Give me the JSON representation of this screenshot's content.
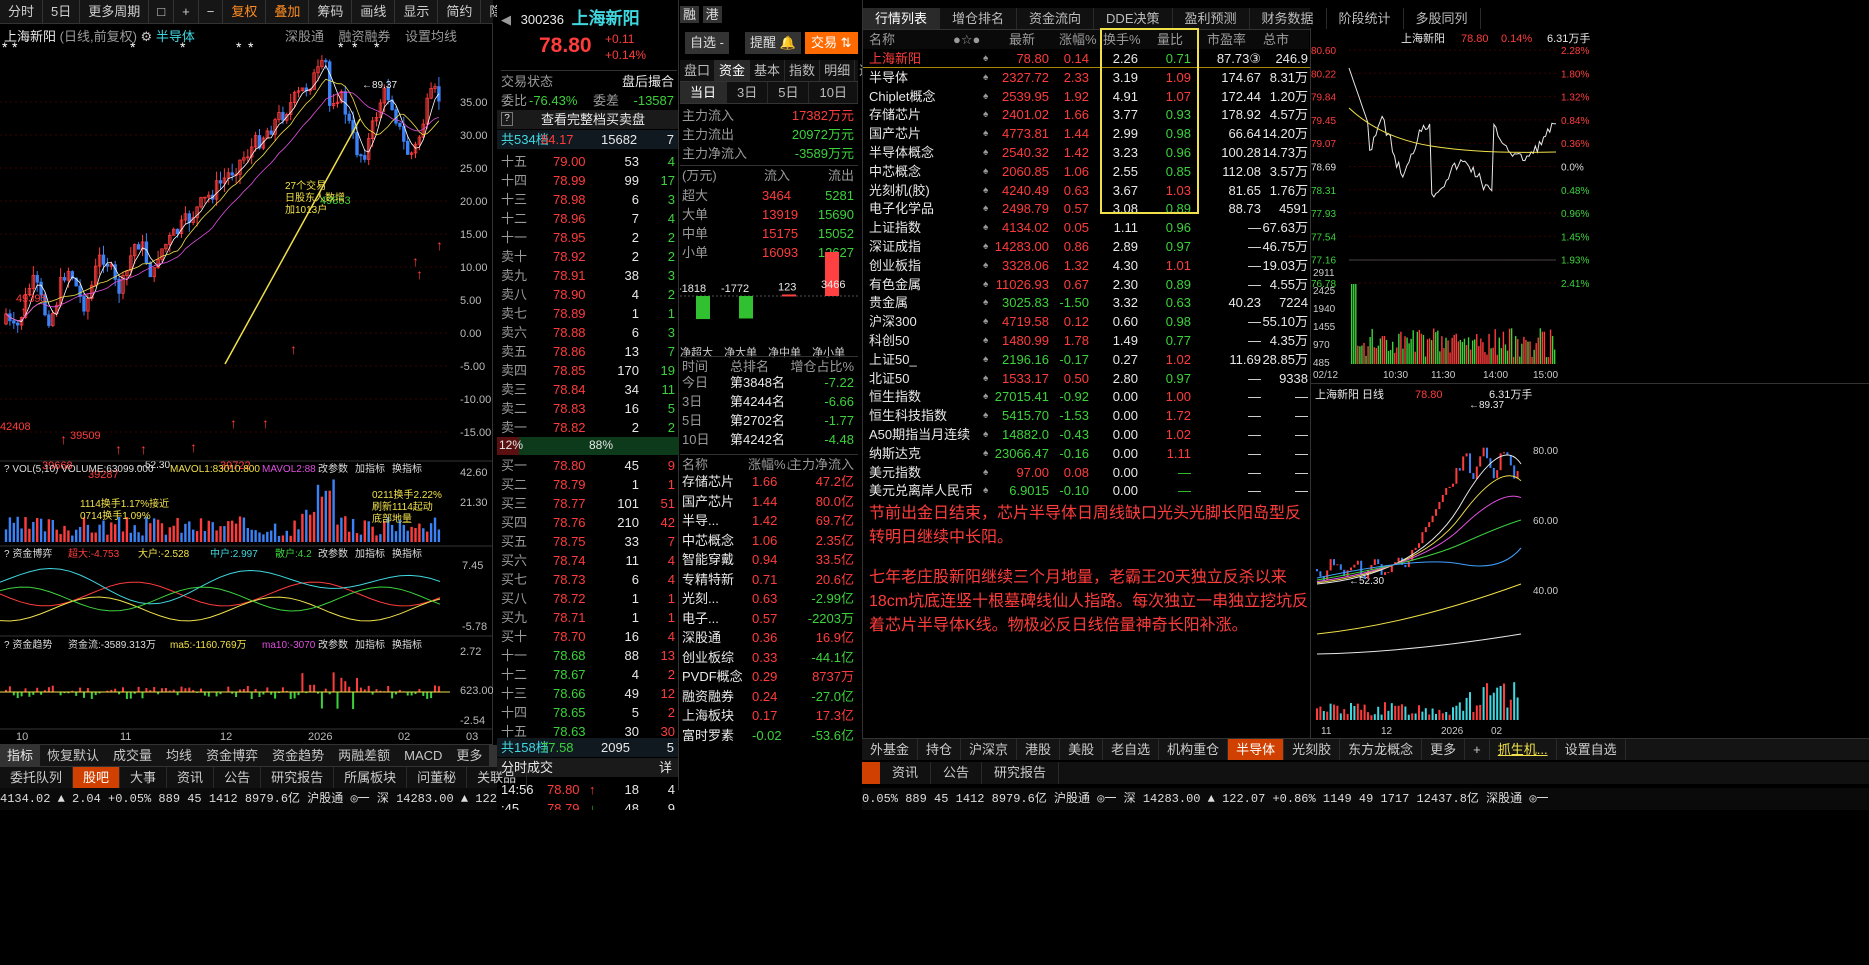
{
  "toolbar": {
    "items": [
      "分时",
      "5日",
      "更多周期",
      "□",
      "+",
      "−",
      "复权",
      "叠加",
      "筹码",
      "画线",
      "显示",
      "简约",
      "隐藏"
    ]
  },
  "kline": {
    "title": "上海新阳",
    "sub": "(日线,前复权)",
    "sector": "半导体",
    "links": [
      "深股通",
      "融资融券",
      "设置均线"
    ],
    "yticks": [
      "35.00",
      "30.00",
      "25.00",
      "20.00",
      "15.00",
      "10.00",
      "5.00",
      "0.00",
      "-5.00",
      "-10.00",
      "-15.00"
    ],
    "high_label": "89.37",
    "low_label": "52.30",
    "price_labels": [
      "49853",
      "42408",
      "49395",
      "39509",
      "39668",
      "39722",
      "39287"
    ],
    "annotation": "27个交易日股东人数增加1013户",
    "vol_header": "VOL(5,10)",
    "vol_text": "VOLUME:63099.000",
    "vol_ma5": "MAVOL1:83010.800",
    "vol_ma10": "MAVOL2:88",
    "vol_params": "改参数",
    "vol_add": "加指标",
    "vol_switch": "换指标",
    "vol_ticks": [
      "42.60",
      "21.30"
    ],
    "vol_note1": "1114换手1.17%接近",
    "vol_note2": "0714换手1.09%",
    "vol_note3": "0211换手2.22%",
    "vol_note4": "刷新1114起动",
    "vol_note5": "底部地量",
    "fund_header": "资金博弈",
    "fund_big": "超大:-4.753",
    "fund_large": "大户:-2.528",
    "fund_mid": "中户:2.997",
    "fund_small": "散户:4.2",
    "fund_params": "改参数",
    "fund_add": "加指标",
    "fund_switch": "换指标",
    "fund_ticks": [
      "7.45",
      "-5.78"
    ],
    "trend_header": "资金趋势",
    "trend_flow": "资金流:-3589.313万",
    "trend_ma5": "ma5:-1160.769万",
    "trend_ma10": "ma10:-3070",
    "trend_params": "改参数",
    "trend_add": "加指标",
    "trend_switch": "换指标",
    "trend_ticks": [
      "2.72",
      "623.00",
      "-2.54"
    ],
    "xaxis": [
      "10",
      "11",
      "12",
      "2026",
      "02",
      "03"
    ],
    "bottom_tabs": [
      "指标",
      "恢复默认",
      "成交量",
      "均线",
      "资金博弈",
      "资金趋势",
      "两融差额",
      "MACD",
      "更多",
      "模板"
    ]
  },
  "quote": {
    "code": "300236",
    "name": "上海新阳",
    "price": "78.80",
    "chg": "+0.11",
    "pct": "+0.14%",
    "tags": [
      "融",
      "港"
    ],
    "btn_watch": "自选 -",
    "btn_alert": "提醒",
    "btn_trade": "交易",
    "status_label": "交易状态",
    "status_val": "盘后撮合",
    "wb_label": "委比",
    "wb_val": "-76.43%",
    "wc_label": "委差",
    "wc_val": "-13587",
    "full_btn": "查看完整档买卖盘",
    "sell_summary": {
      "label": "共534档",
      "price": "84.17",
      "vol": "15682",
      "cnt": "7"
    },
    "sells": [
      [
        "十五",
        "79.00",
        "53",
        "4"
      ],
      [
        "十四",
        "78.99",
        "99",
        "17"
      ],
      [
        "十三",
        "78.98",
        "6",
        "3"
      ],
      [
        "十二",
        "78.96",
        "7",
        "4"
      ],
      [
        "十一",
        "78.95",
        "2",
        "2"
      ],
      [
        "卖十",
        "78.92",
        "2",
        "2"
      ],
      [
        "卖九",
        "78.91",
        "38",
        "3"
      ],
      [
        "卖八",
        "78.90",
        "4",
        "2"
      ],
      [
        "卖七",
        "78.89",
        "1",
        "1"
      ],
      [
        "卖六",
        "78.88",
        "6",
        "3"
      ],
      [
        "卖五",
        "78.86",
        "13",
        "7"
      ],
      [
        "卖四",
        "78.85",
        "170",
        "19"
      ],
      [
        "卖三",
        "78.84",
        "34",
        "11"
      ],
      [
        "卖二",
        "78.83",
        "16",
        "5"
      ],
      [
        "卖一",
        "78.82",
        "2",
        "2"
      ]
    ],
    "ratio_left": "12%",
    "ratio_mid": "88%",
    "buys": [
      [
        "买一",
        "78.80",
        "45",
        "9"
      ],
      [
        "买二",
        "78.79",
        "1",
        "1"
      ],
      [
        "买三",
        "78.77",
        "101",
        "51"
      ],
      [
        "买四",
        "78.76",
        "210",
        "42"
      ],
      [
        "买五",
        "78.75",
        "33",
        "7"
      ],
      [
        "买六",
        "78.74",
        "11",
        "4"
      ],
      [
        "买七",
        "78.73",
        "6",
        "4"
      ],
      [
        "买八",
        "78.72",
        "1",
        "1"
      ],
      [
        "买九",
        "78.71",
        "1",
        "1"
      ],
      [
        "买十",
        "78.70",
        "16",
        "4"
      ],
      [
        "十一",
        "78.68",
        "88",
        "13"
      ],
      [
        "十二",
        "78.67",
        "4",
        "2"
      ],
      [
        "十三",
        "78.66",
        "49",
        "12"
      ],
      [
        "十四",
        "78.65",
        "5",
        "2"
      ],
      [
        "十五",
        "78.63",
        "30",
        "30"
      ]
    ],
    "buy_summary": {
      "label": "共158档",
      "price": "77.58",
      "vol": "2095",
      "cnt": "5"
    },
    "ticks_title": "分时成交",
    "ticks_detail": "详",
    "ticks": [
      [
        "14:56",
        "78.80",
        "↑",
        "18",
        "4"
      ],
      [
        ":45",
        "78.79",
        "↓",
        "48",
        "9"
      ],
      [
        ":48",
        "78.78",
        "↓",
        "16",
        "4"
      ],
      [
        ":51",
        "78.78",
        "",
        "19",
        "8"
      ],
      [
        ":54",
        "78.77",
        "↓",
        "28",
        "3"
      ],
      [
        ":57",
        "78.76",
        "↓",
        "5",
        "3"
      ],
      [
        "14:57",
        "78.80",
        "↑",
        "2",
        "1"
      ],
      [
        "15:00",
        "78.80",
        "",
        "1144",
        "231"
      ]
    ]
  },
  "fund": {
    "tabs": [
      "盘口",
      "资金",
      "基本",
      "指数",
      "明细",
      "逐笔"
    ],
    "periods": [
      "当日",
      "3日",
      "5日",
      "10日"
    ],
    "main_in_label": "主力流入",
    "main_in": "17382万元",
    "main_out_label": "主力流出",
    "main_out": "20972万元",
    "main_net_label": "主力净流入",
    "main_net": "-3589万元",
    "table_head": [
      "(万元)",
      "流入",
      "流出"
    ],
    "rows": [
      [
        "超大",
        "3464",
        "5281"
      ],
      [
        "大单",
        "13919",
        "15690"
      ],
      [
        "中单",
        "15175",
        "15052"
      ],
      [
        "小单",
        "16093",
        "12627"
      ]
    ],
    "bars": [
      -1818,
      -1772,
      123,
      3466
    ],
    "bar_labels": [
      "-1818",
      "-1772",
      "123",
      "3466"
    ],
    "bar_cats": [
      "净超大",
      "净大单",
      "净中单",
      "净小单"
    ],
    "rank_head": [
      "时间",
      "总排名",
      "增仓占比%"
    ],
    "ranks": [
      [
        "今日",
        "第3848名",
        "-7.22"
      ],
      [
        "3日",
        "第4244名",
        "-6.66"
      ],
      [
        "5日",
        "第2702名",
        "-1.77"
      ],
      [
        "10日",
        "第4242名",
        "-4.48"
      ]
    ],
    "sec_head": [
      "名称",
      "涨幅%↓",
      "主力净流入"
    ],
    "sectors": [
      [
        "存储芯片",
        "1.66",
        "47.2亿"
      ],
      [
        "国产芯片",
        "1.44",
        "80.0亿"
      ],
      [
        "半导...",
        "1.42",
        "69.7亿"
      ],
      [
        "中芯概念",
        "1.06",
        "2.35亿"
      ],
      [
        "智能穿戴",
        "0.94",
        "33.5亿"
      ],
      [
        "专精特新",
        "0.71",
        "20.6亿"
      ],
      [
        "光刻...",
        "0.63",
        "-2.99亿"
      ],
      [
        "电子...",
        "0.57",
        "-2203万"
      ],
      [
        "深股通",
        "0.36",
        "16.9亿"
      ],
      [
        "创业板综",
        "0.33",
        "-44.1亿"
      ],
      [
        "PVDF概念",
        "0.29",
        "8737万"
      ],
      [
        "融资融券",
        "0.24",
        "-27.0亿"
      ],
      [
        "上海板块",
        "0.17",
        "17.3亿"
      ],
      [
        "富时罗素",
        "-0.02",
        "-53.6亿"
      ]
    ]
  },
  "market": {
    "tabs": [
      "行情列表",
      "增仓排名",
      "资金流向",
      "DDE决策",
      "盈利预测",
      "财务数据",
      "阶段统计",
      "多股同列"
    ],
    "head": [
      "名称",
      "●☆●",
      "最新",
      "涨幅%",
      "换手%",
      "量比",
      "市盈率",
      "总市"
    ],
    "rows": [
      [
        "上海新阳",
        "78.80",
        "0.14",
        "2.26",
        "0.71",
        "87.73③",
        "246.9"
      ],
      [
        "半导体",
        "2327.72",
        "2.33",
        "3.19",
        "1.09",
        "174.67",
        "8.31万"
      ],
      [
        "Chiplet概念",
        "2539.95",
        "1.92",
        "4.91",
        "1.07",
        "172.44",
        "1.20万"
      ],
      [
        "存储芯片",
        "2401.02",
        "1.66",
        "3.77",
        "0.93",
        "178.92",
        "4.57万"
      ],
      [
        "国产芯片",
        "4773.81",
        "1.44",
        "2.99",
        "0.98",
        "66.64",
        "14.20万"
      ],
      [
        "半导体概念",
        "2540.32",
        "1.42",
        "3.23",
        "0.96",
        "100.28",
        "14.73万"
      ],
      [
        "中芯概念",
        "2060.85",
        "1.06",
        "2.55",
        "0.85",
        "112.08",
        "3.57万"
      ],
      [
        "光刻机(胶)",
        "4240.49",
        "0.63",
        "3.67",
        "1.03",
        "81.65",
        "1.76万"
      ],
      [
        "电子化学品",
        "2498.79",
        "0.57",
        "3.08",
        "0.89",
        "88.73",
        "4591"
      ],
      [
        "上证指数",
        "4134.02",
        "0.05",
        "1.11",
        "0.96",
        "—",
        "67.63万"
      ],
      [
        "深证成指",
        "14283.00",
        "0.86",
        "2.89",
        "0.97",
        "—",
        "46.75万"
      ],
      [
        "创业板指",
        "3328.06",
        "1.32",
        "4.30",
        "1.01",
        "—",
        "19.03万"
      ],
      [
        "有色金属",
        "11026.93",
        "0.67",
        "2.30",
        "0.89",
        "—",
        "4.55万"
      ],
      [
        "贵金属",
        "3025.83",
        "-1.50",
        "3.32",
        "0.63",
        "40.23",
        "7224"
      ],
      [
        "沪深300",
        "4719.58",
        "0.12",
        "0.60",
        "0.98",
        "—",
        "55.10万"
      ],
      [
        "科创50",
        "1480.99",
        "1.78",
        "1.49",
        "0.77",
        "—",
        "4.35万"
      ],
      [
        "上证50_",
        "2196.16",
        "-0.17",
        "0.27",
        "1.02",
        "11.69",
        "28.85万"
      ],
      [
        "北证50",
        "1533.17",
        "0.50",
        "2.80",
        "0.97",
        "—",
        "9338"
      ],
      [
        "恒生指数",
        "27015.41",
        "-0.92",
        "0.00",
        "1.00",
        "—",
        "—"
      ],
      [
        "恒生科技指数",
        "5415.70",
        "-1.53",
        "0.00",
        "1.72",
        "—",
        "—"
      ],
      [
        "A50期指当月连续",
        "14882.0",
        "-0.43",
        "0.00",
        "1.02",
        "—",
        "—"
      ],
      [
        "纳斯达克",
        "23066.47",
        "-0.16",
        "0.00",
        "1.11",
        "—",
        "—"
      ],
      [
        "美元指数",
        "97.00",
        "0.08",
        "0.00",
        "—",
        "—",
        "—"
      ],
      [
        "美元兑离岸人民币",
        "6.9015",
        "-0.10",
        "0.00",
        "—",
        "—",
        "—"
      ]
    ],
    "commentary1": "节前出金日结束，芯片半导体日周线缺口光头光脚长阳岛型反转明日继续中长阳。",
    "commentary2": "七年老庄股新阳继续三个月地量，老霸王20天独立反杀以来18cm坑底连竖十根墓碑线仙人指路。每次独立一串独立挖坑反着芯片半导体K线。物极必反日线倍量神奇长阳补涨。",
    "bottom_tabs": [
      "外基金",
      "持仓",
      "沪深京",
      "港股",
      "美股",
      "老自选",
      "机构重仓",
      "半导体",
      "光刻胶",
      "东方龙概念",
      "更多",
      "+",
      "抓生机...",
      "设置自选"
    ]
  },
  "mini": {
    "name": "上海新阳",
    "price": "78.80",
    "pct": "0.14%",
    "amt": "6.31万手",
    "yticks": [
      "80.60",
      "80.22",
      "79.84",
      "79.45",
      "79.07",
      "78.69",
      "78.31",
      "77.93",
      "77.54",
      "77.16",
      "76.78"
    ],
    "pticks": [
      "2.28%",
      "1.80%",
      "1.32%",
      "0.84%",
      "0.36%",
      "0.0%",
      "0.48%",
      "0.96%",
      "1.45%",
      "1.93%",
      "2.41%"
    ],
    "vticks": [
      "2911",
      "2425",
      "1940",
      "1455",
      "970",
      "485"
    ],
    "xticks": [
      "02/12",
      "10:30",
      "11:30",
      "14:00",
      "15:00"
    ],
    "day_title": "上海新阳 日线",
    "day_price": "78.80",
    "day_amt": "6.31万手",
    "day_high": "89.37",
    "day_low": "52.30",
    "day_ticks": [
      "80.00",
      "60.00",
      "40.00"
    ],
    "day_x": [
      "11",
      "12",
      "2026",
      "02"
    ]
  },
  "status": {
    "left_tabs": [
      "委托队列",
      "股吧",
      "大事",
      "资讯",
      "公告",
      "研究报告",
      "所属板块",
      "问董秘",
      "关联品"
    ],
    "right_tabs": [
      "资讯",
      "公告",
      "研究报告"
    ],
    "line": "4134.02 ▲ 2.04 +0.05% 889 45 1412 8979.6亿 沪股通 ◎一 深 14283.00 ▲ 122.07 +0.86% 1149 49 1717 12437.8亿 深股通 ◎一",
    "line2": "0.05% 889 45 1412 8979.6亿 沪股通 ◎一 深 14283.00 ▲ 122.07 +0.86% 1149 49 1717 12437.8亿 深股通 ◎一"
  },
  "colors": {
    "red": "#ff3c3c",
    "green": "#3cd23c",
    "yellow": "#f0e04a",
    "blue": "#3b82f6"
  }
}
